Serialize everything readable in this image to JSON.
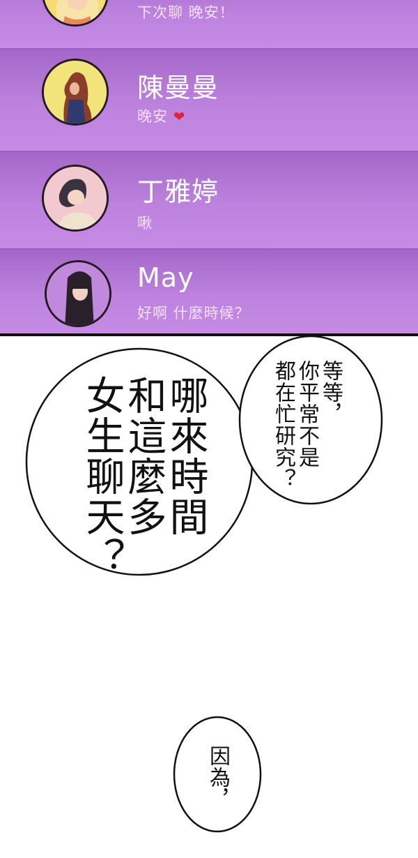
{
  "chats": [
    {
      "name": "",
      "preview": "下次聊 晚安！",
      "avatar": "blonde-woman-avatar"
    },
    {
      "name": "陳曼曼",
      "preview": "晚安",
      "heart": "❤",
      "avatar": "redhead-woman-avatar"
    },
    {
      "name": "丁雅婷",
      "preview": "啾",
      "avatar": "dark-hair-woman-avatar"
    },
    {
      "name": "May",
      "preview": "好啊 什麼時候？",
      "avatar": "long-hair-woman-avatar"
    }
  ],
  "bubbles": {
    "big": [
      "哪來時間",
      "和這麼多",
      "女生聊天？"
    ],
    "right": [
      "等等，",
      "你平常不是",
      "都在忙研究？"
    ],
    "bottom": [
      "因為，"
    ]
  },
  "colors": {
    "panel": "#b67cd6",
    "row_top": "#a467c9",
    "row_bottom": "#c68be4",
    "name_text": "#ffffff",
    "preview_text": "#f1e2fb",
    "heart": "#e0203c"
  }
}
